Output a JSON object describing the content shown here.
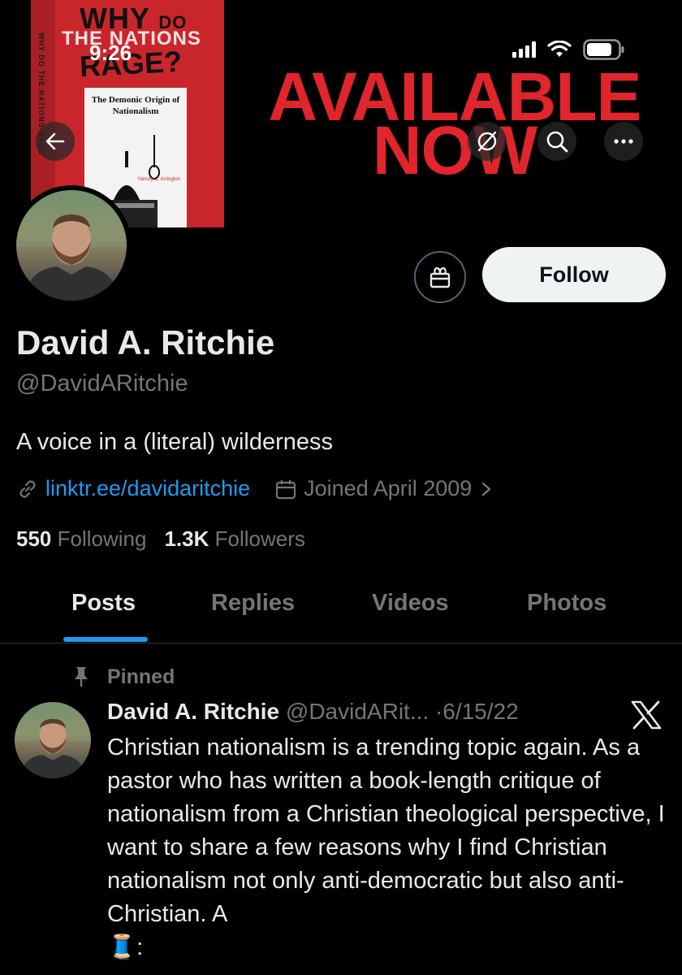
{
  "status_bar": {
    "time": "9:26"
  },
  "banner": {
    "book": {
      "title_line1": "WHY",
      "title_line1_small": "DO",
      "title_line2": "THE NATIONS",
      "title_line3": "RAGE?",
      "subtitle": "The Demonic Origin of Nationalism",
      "author": "Yancey C. Arrington",
      "spine": "WHY DO THE NATIONS RAGE"
    },
    "promo_line1": "AVAILABLE",
    "promo_line2": "NOW"
  },
  "nav": {
    "back_icon": "arrow-left-icon",
    "grok_icon": "grok-slash-icon",
    "search_icon": "search-icon",
    "more_icon": "more-dots-icon"
  },
  "profile": {
    "follow_label": "Follow",
    "name": "David A. Ritchie",
    "handle": "@DavidARitchie",
    "bio": "A voice in a (literal) wilderness",
    "link": "linktr.ee/davidaritchie",
    "joined": "Joined April 2009",
    "following_count": "550",
    "following_label": "Following",
    "followers_count": "1.3K",
    "followers_label": "Followers"
  },
  "tabs": [
    {
      "label": "Posts",
      "active": true
    },
    {
      "label": "Replies",
      "active": false
    },
    {
      "label": "Videos",
      "active": false
    },
    {
      "label": "Photos",
      "active": false
    }
  ],
  "pinned_post": {
    "pinned_label": "Pinned",
    "author_name": "David A. Ritchie",
    "author_handle": "@DavidARit...",
    "date": "·6/15/22",
    "text": "Christian nationalism is a trending topic again. As a pastor who has written a book-length critique of nationalism from a Christian theological perspective, I want to share a few reasons why I find Christian nationalism not only anti-democratic but also anti-Christian. A",
    "text_end": "🧵:"
  },
  "colors": {
    "accent": "#1d9bf0",
    "banner_red": "#e0252c",
    "muted": "#71767b"
  }
}
